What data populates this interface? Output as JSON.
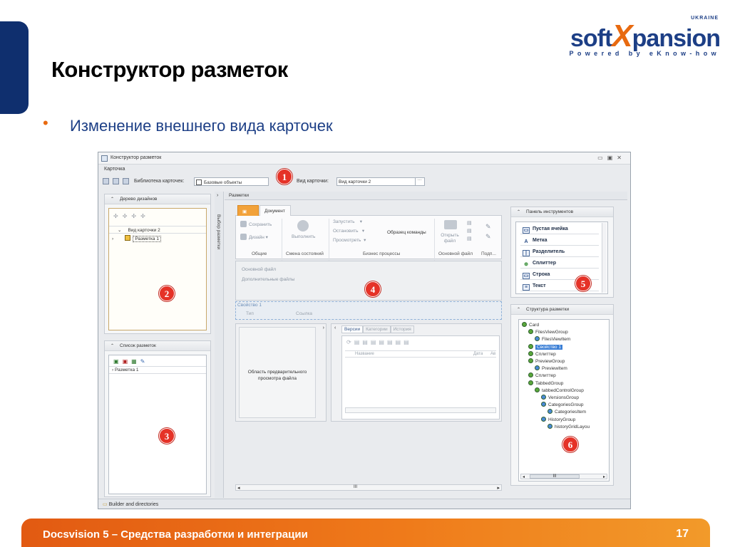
{
  "slide": {
    "logo": {
      "soft": "soft",
      "x": "X",
      "pansion": "pansion",
      "country": "UKRAINE",
      "tagline": "Powered by eKnow-how"
    },
    "title": "Конструктор разметок",
    "bullet": "Изменение внешнего вида карточек",
    "footer_text": "Docsvision 5 – Средства разработки и интеграции",
    "page_number": "17",
    "colors": {
      "brand_blue": "#1d3f86",
      "accent_orange": "#e86a10",
      "marker_red": "#e53227"
    }
  },
  "window": {
    "title": "Конструктор разметок",
    "menu": "Карточка",
    "library_label": "Библиотека карточек:",
    "library_value": "Базовые объекты",
    "card_type_label": "Вид карточки:",
    "card_type_value": "Вид карточки 2",
    "markers": [
      "1",
      "2",
      "3",
      "4",
      "5",
      "6"
    ],
    "design_tree": {
      "header": "Дерево дизайнов",
      "items": [
        "Вид карточки 2",
        "Разметка 1"
      ]
    },
    "layout_list": {
      "header": "Список разметок",
      "items": [
        "Разметка 1"
      ]
    },
    "vertical_tab": "Выбор разметки",
    "layouts_header": "Разметки",
    "ribbon": {
      "tab_document": "Документ",
      "save": "Сохранить",
      "design": "Дизайн",
      "execute": "Выполнить",
      "start": "Запустить",
      "stop": "Остановить",
      "view": "Просмотреть",
      "sample_commands": "Образец команды",
      "open_file": "Открыть файл",
      "groups": [
        "Общие",
        "Смена состояний",
        "Бизнес процессы",
        "Основной файл",
        "Подп..."
      ]
    },
    "document": {
      "main_file": "Основной файл",
      "extra_files": "Дополнительные файлы",
      "properties": "Свойство 1",
      "type_col": "Тип",
      "link_col": "Ссылка"
    },
    "preview_area": "Область предварительного просмотра файла",
    "bottom_tabs": [
      "Версии",
      "Категории",
      "История"
    ],
    "grid_cols": [
      "Название",
      "Дата",
      "Ав"
    ],
    "scroll_label": "III",
    "toolbox": {
      "header": "Панель инструментов",
      "items": [
        {
          "icon": "empty-cell-icon",
          "label": "Пустая ячейка"
        },
        {
          "icon": "label-icon",
          "label": "Метка"
        },
        {
          "icon": "separator-icon",
          "label": "Разделитель"
        },
        {
          "icon": "splitter-icon",
          "label": "Сплиттер"
        },
        {
          "icon": "string-icon",
          "label": "Строка"
        },
        {
          "icon": "text-icon",
          "label": "Текст"
        }
      ]
    },
    "structure": {
      "header": "Структура разметки",
      "nodes": [
        {
          "label": "Card",
          "level": 0
        },
        {
          "label": "FilesViewGroup",
          "level": 1
        },
        {
          "label": "FilesViewItem",
          "level": 2
        },
        {
          "label": "Свойство 1",
          "level": 1,
          "selected": true
        },
        {
          "label": "Сплиттер",
          "level": 1
        },
        {
          "label": "PreviewGroup",
          "level": 1
        },
        {
          "label": "PreviewItem",
          "level": 2
        },
        {
          "label": "Сплиттер",
          "level": 1
        },
        {
          "label": "TabbedGroup",
          "level": 1
        },
        {
          "label": "tabbedControlGroup",
          "level": 2
        },
        {
          "label": "VersionsGroup",
          "level": 3
        },
        {
          "label": "CategoriesGroup",
          "level": 3
        },
        {
          "label": "CategoriesItem",
          "level": 4
        },
        {
          "label": "HistoryGroup",
          "level": 3
        },
        {
          "label": "historyGridLayou",
          "level": 4
        }
      ]
    },
    "status": "Builder and directories"
  }
}
